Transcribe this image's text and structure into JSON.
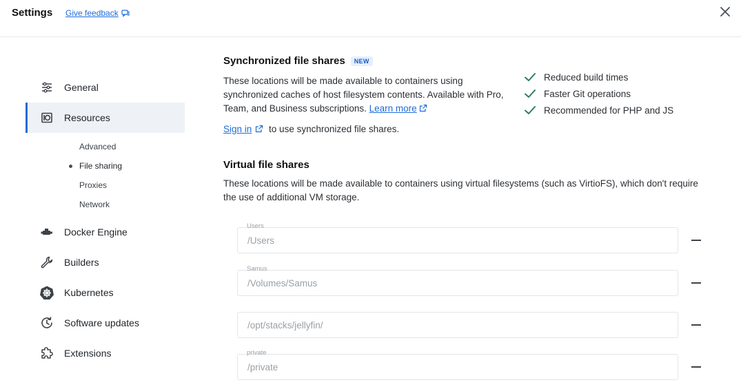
{
  "header": {
    "title": "Settings",
    "feedback_label": "Give feedback"
  },
  "sidebar": {
    "items": [
      {
        "label": "General",
        "icon": "sliders-icon"
      },
      {
        "label": "Resources",
        "icon": "resources-icon",
        "active": true
      },
      {
        "label": "Docker Engine",
        "icon": "engine-icon"
      },
      {
        "label": "Builders",
        "icon": "wrench-icon"
      },
      {
        "label": "Kubernetes",
        "icon": "kubernetes-icon"
      },
      {
        "label": "Software updates",
        "icon": "clock-update-icon"
      },
      {
        "label": "Extensions",
        "icon": "puzzle-icon"
      }
    ],
    "sub_items": [
      {
        "label": "Advanced"
      },
      {
        "label": "File sharing",
        "current": true
      },
      {
        "label": "Proxies"
      },
      {
        "label": "Network"
      }
    ]
  },
  "sync": {
    "title": "Synchronized file shares",
    "badge": "NEW",
    "description": "These locations will be made available to containers using synchronized caches of host filesystem contents. Available with Pro, Team, and Business subscriptions.",
    "learn_more": "Learn more",
    "sign_in": "Sign in",
    "sign_in_suffix": "to use synchronized file shares.",
    "benefits": [
      "Reduced build times",
      "Faster Git operations",
      "Recommended for PHP and JS"
    ]
  },
  "virtual": {
    "title": "Virtual file shares",
    "description": "These locations will be made available to containers using virtual filesystems (such as VirtioFS), which don't require the use of additional VM storage.",
    "shares": [
      {
        "label": "Users",
        "path": "/Users"
      },
      {
        "label": "Samus",
        "path": "/Volumes/Samus"
      },
      {
        "label": "",
        "path": "/opt/stacks/jellyfin/"
      },
      {
        "label": "private",
        "path": "/private"
      }
    ]
  },
  "colors": {
    "accent": "#1d6bd9",
    "check": "#2e7d5b",
    "active_bg": "#eef1f6"
  }
}
